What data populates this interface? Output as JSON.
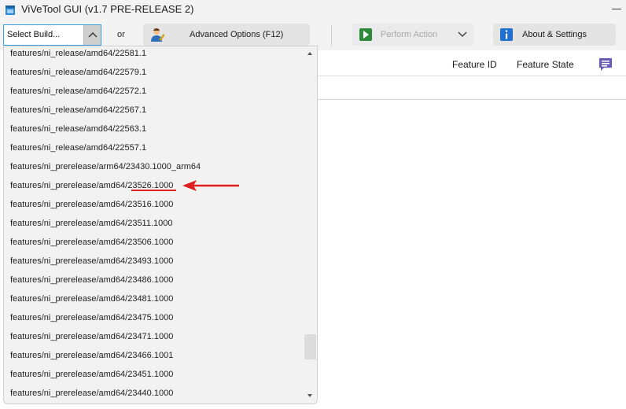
{
  "window": {
    "title": "ViVeTool GUI (v1.7 PRE-RELEASE 2)",
    "icon": "app-window-icon"
  },
  "toolbar": {
    "build_select_value": "Select Build...",
    "or_label": "or",
    "advanced_options_label": "Advanced Options (F12)",
    "perform_action_label": "Perform Action",
    "about_settings_label": "About & Settings"
  },
  "grid": {
    "columns": [
      "Feature ID",
      "Feature State"
    ]
  },
  "dropdown": {
    "items": [
      "features/ni_release/amd64/22581.1",
      "features/ni_release/amd64/22579.1",
      "features/ni_release/amd64/22572.1",
      "features/ni_release/amd64/22567.1",
      "features/ni_release/amd64/22563.1",
      "features/ni_release/amd64/22557.1",
      "features/ni_prerelease/arm64/23430.1000_arm64",
      "features/ni_prerelease/amd64/23526.1000",
      "features/ni_prerelease/amd64/23516.1000",
      "features/ni_prerelease/amd64/23511.1000",
      "features/ni_prerelease/amd64/23506.1000",
      "features/ni_prerelease/amd64/23493.1000",
      "features/ni_prerelease/amd64/23486.1000",
      "features/ni_prerelease/amd64/23481.1000",
      "features/ni_prerelease/amd64/23475.1000",
      "features/ni_prerelease/amd64/23471.1000",
      "features/ni_prerelease/amd64/23466.1001",
      "features/ni_prerelease/amd64/23451.1000",
      "features/ni_prerelease/amd64/23440.1000"
    ],
    "annotated_index": 7
  },
  "colors": {
    "accent_border": "#3aa0e6",
    "annotation_red": "#e02020",
    "comment_icon": "#6b5bb5"
  }
}
